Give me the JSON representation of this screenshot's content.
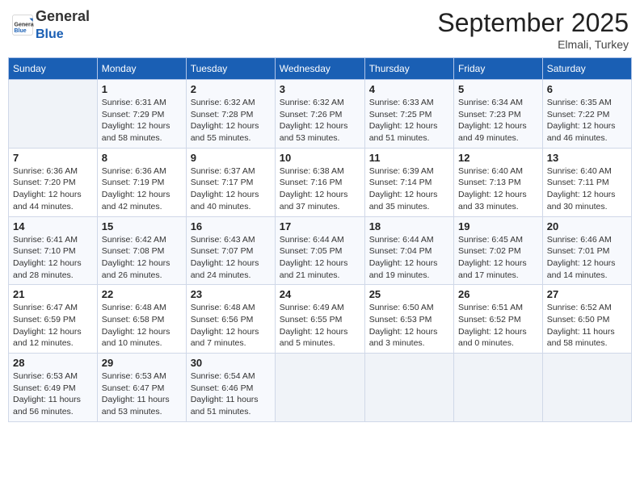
{
  "header": {
    "logo_general": "General",
    "logo_blue": "Blue",
    "month_title": "September 2025",
    "location": "Elmali, Turkey"
  },
  "days_of_week": [
    "Sunday",
    "Monday",
    "Tuesday",
    "Wednesday",
    "Thursday",
    "Friday",
    "Saturday"
  ],
  "weeks": [
    [
      {
        "day": "",
        "info": ""
      },
      {
        "day": "1",
        "info": "Sunrise: 6:31 AM\nSunset: 7:29 PM\nDaylight: 12 hours\nand 58 minutes."
      },
      {
        "day": "2",
        "info": "Sunrise: 6:32 AM\nSunset: 7:28 PM\nDaylight: 12 hours\nand 55 minutes."
      },
      {
        "day": "3",
        "info": "Sunrise: 6:32 AM\nSunset: 7:26 PM\nDaylight: 12 hours\nand 53 minutes."
      },
      {
        "day": "4",
        "info": "Sunrise: 6:33 AM\nSunset: 7:25 PM\nDaylight: 12 hours\nand 51 minutes."
      },
      {
        "day": "5",
        "info": "Sunrise: 6:34 AM\nSunset: 7:23 PM\nDaylight: 12 hours\nand 49 minutes."
      },
      {
        "day": "6",
        "info": "Sunrise: 6:35 AM\nSunset: 7:22 PM\nDaylight: 12 hours\nand 46 minutes."
      }
    ],
    [
      {
        "day": "7",
        "info": "Sunrise: 6:36 AM\nSunset: 7:20 PM\nDaylight: 12 hours\nand 44 minutes."
      },
      {
        "day": "8",
        "info": "Sunrise: 6:36 AM\nSunset: 7:19 PM\nDaylight: 12 hours\nand 42 minutes."
      },
      {
        "day": "9",
        "info": "Sunrise: 6:37 AM\nSunset: 7:17 PM\nDaylight: 12 hours\nand 40 minutes."
      },
      {
        "day": "10",
        "info": "Sunrise: 6:38 AM\nSunset: 7:16 PM\nDaylight: 12 hours\nand 37 minutes."
      },
      {
        "day": "11",
        "info": "Sunrise: 6:39 AM\nSunset: 7:14 PM\nDaylight: 12 hours\nand 35 minutes."
      },
      {
        "day": "12",
        "info": "Sunrise: 6:40 AM\nSunset: 7:13 PM\nDaylight: 12 hours\nand 33 minutes."
      },
      {
        "day": "13",
        "info": "Sunrise: 6:40 AM\nSunset: 7:11 PM\nDaylight: 12 hours\nand 30 minutes."
      }
    ],
    [
      {
        "day": "14",
        "info": "Sunrise: 6:41 AM\nSunset: 7:10 PM\nDaylight: 12 hours\nand 28 minutes."
      },
      {
        "day": "15",
        "info": "Sunrise: 6:42 AM\nSunset: 7:08 PM\nDaylight: 12 hours\nand 26 minutes."
      },
      {
        "day": "16",
        "info": "Sunrise: 6:43 AM\nSunset: 7:07 PM\nDaylight: 12 hours\nand 24 minutes."
      },
      {
        "day": "17",
        "info": "Sunrise: 6:44 AM\nSunset: 7:05 PM\nDaylight: 12 hours\nand 21 minutes."
      },
      {
        "day": "18",
        "info": "Sunrise: 6:44 AM\nSunset: 7:04 PM\nDaylight: 12 hours\nand 19 minutes."
      },
      {
        "day": "19",
        "info": "Sunrise: 6:45 AM\nSunset: 7:02 PM\nDaylight: 12 hours\nand 17 minutes."
      },
      {
        "day": "20",
        "info": "Sunrise: 6:46 AM\nSunset: 7:01 PM\nDaylight: 12 hours\nand 14 minutes."
      }
    ],
    [
      {
        "day": "21",
        "info": "Sunrise: 6:47 AM\nSunset: 6:59 PM\nDaylight: 12 hours\nand 12 minutes."
      },
      {
        "day": "22",
        "info": "Sunrise: 6:48 AM\nSunset: 6:58 PM\nDaylight: 12 hours\nand 10 minutes."
      },
      {
        "day": "23",
        "info": "Sunrise: 6:48 AM\nSunset: 6:56 PM\nDaylight: 12 hours\nand 7 minutes."
      },
      {
        "day": "24",
        "info": "Sunrise: 6:49 AM\nSunset: 6:55 PM\nDaylight: 12 hours\nand 5 minutes."
      },
      {
        "day": "25",
        "info": "Sunrise: 6:50 AM\nSunset: 6:53 PM\nDaylight: 12 hours\nand 3 minutes."
      },
      {
        "day": "26",
        "info": "Sunrise: 6:51 AM\nSunset: 6:52 PM\nDaylight: 12 hours\nand 0 minutes."
      },
      {
        "day": "27",
        "info": "Sunrise: 6:52 AM\nSunset: 6:50 PM\nDaylight: 11 hours\nand 58 minutes."
      }
    ],
    [
      {
        "day": "28",
        "info": "Sunrise: 6:53 AM\nSunset: 6:49 PM\nDaylight: 11 hours\nand 56 minutes."
      },
      {
        "day": "29",
        "info": "Sunrise: 6:53 AM\nSunset: 6:47 PM\nDaylight: 11 hours\nand 53 minutes."
      },
      {
        "day": "30",
        "info": "Sunrise: 6:54 AM\nSunset: 6:46 PM\nDaylight: 11 hours\nand 51 minutes."
      },
      {
        "day": "",
        "info": ""
      },
      {
        "day": "",
        "info": ""
      },
      {
        "day": "",
        "info": ""
      },
      {
        "day": "",
        "info": ""
      }
    ]
  ]
}
